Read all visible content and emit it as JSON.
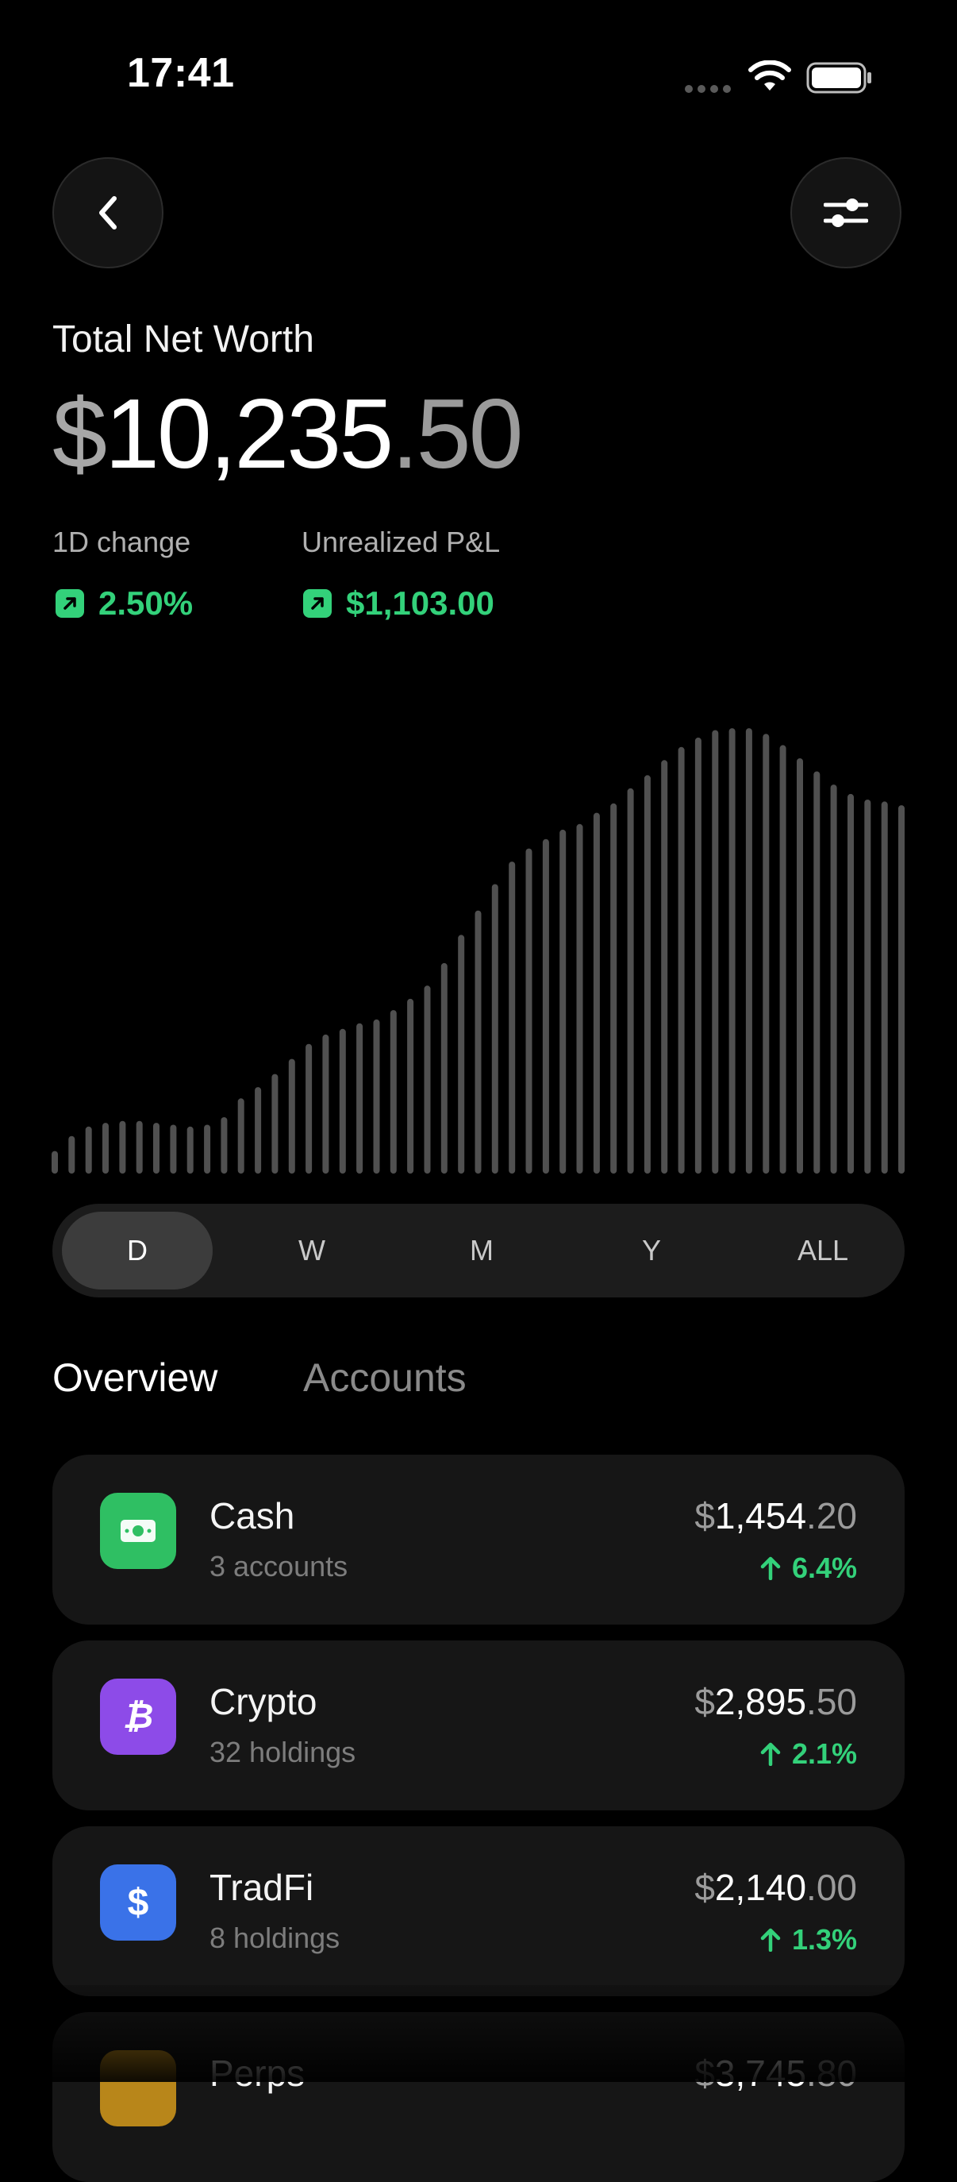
{
  "status_bar": {
    "time": "17:41",
    "icons": [
      "cellular-dots-icon",
      "wifi-icon",
      "battery-icon"
    ]
  },
  "header": {
    "back_icon": "chevron-left-icon",
    "filter_icon": "sliders-icon"
  },
  "net_worth": {
    "title": "Total Net Worth",
    "currency": "$",
    "whole": "10,235",
    "cents": ".50"
  },
  "metrics": {
    "day_change": {
      "label": "1D change",
      "value": "2.50%"
    },
    "unrealized": {
      "label": "Unrealized P&L",
      "value": "$1,103.00"
    }
  },
  "chart_data": {
    "type": "bar",
    "values": [
      12,
      20,
      25,
      27,
      28,
      28,
      27,
      26,
      25,
      26,
      30,
      40,
      46,
      53,
      61,
      69,
      74,
      77,
      80,
      82,
      87,
      93,
      100,
      112,
      127,
      140,
      154,
      166,
      173,
      178,
      183,
      186,
      192,
      197,
      205,
      212,
      220,
      227,
      232,
      236,
      237,
      237,
      234,
      228,
      221,
      214,
      207,
      202,
      199,
      198,
      196
    ],
    "ylim": [
      0,
      240
    ],
    "color": "#505050"
  },
  "timeframes": {
    "options": [
      "D",
      "W",
      "M",
      "Y",
      "ALL"
    ],
    "selected": "D"
  },
  "tabs": {
    "overview": "Overview",
    "accounts": "Accounts"
  },
  "accounts": [
    {
      "name": "Cash",
      "sub": "3 accounts",
      "currency": "$",
      "whole": "1,454",
      "cents": ".20",
      "change": "6.4%",
      "icon": "banknote-icon",
      "color": "#2fbf63"
    },
    {
      "name": "Crypto",
      "sub": "32 holdings",
      "currency": "$",
      "whole": "2,895",
      "cents": ".50",
      "change": "2.1%",
      "icon": "bitcoin-icon",
      "color": "#8d4be8"
    },
    {
      "name": "TradFi",
      "sub": "8 holdings",
      "currency": "$",
      "whole": "2,140",
      "cents": ".00",
      "change": "1.3%",
      "icon": "dollar-icon",
      "color": "#3a72e8"
    },
    {
      "name": "Perps",
      "sub": "",
      "currency": "$",
      "whole": "3,745",
      "cents": ".80",
      "change": "",
      "icon": "perps-icon",
      "color": "#b8861a"
    }
  ],
  "colors": {
    "accent_green": "#33d17a",
    "background": "#000000",
    "card": "#161616"
  }
}
